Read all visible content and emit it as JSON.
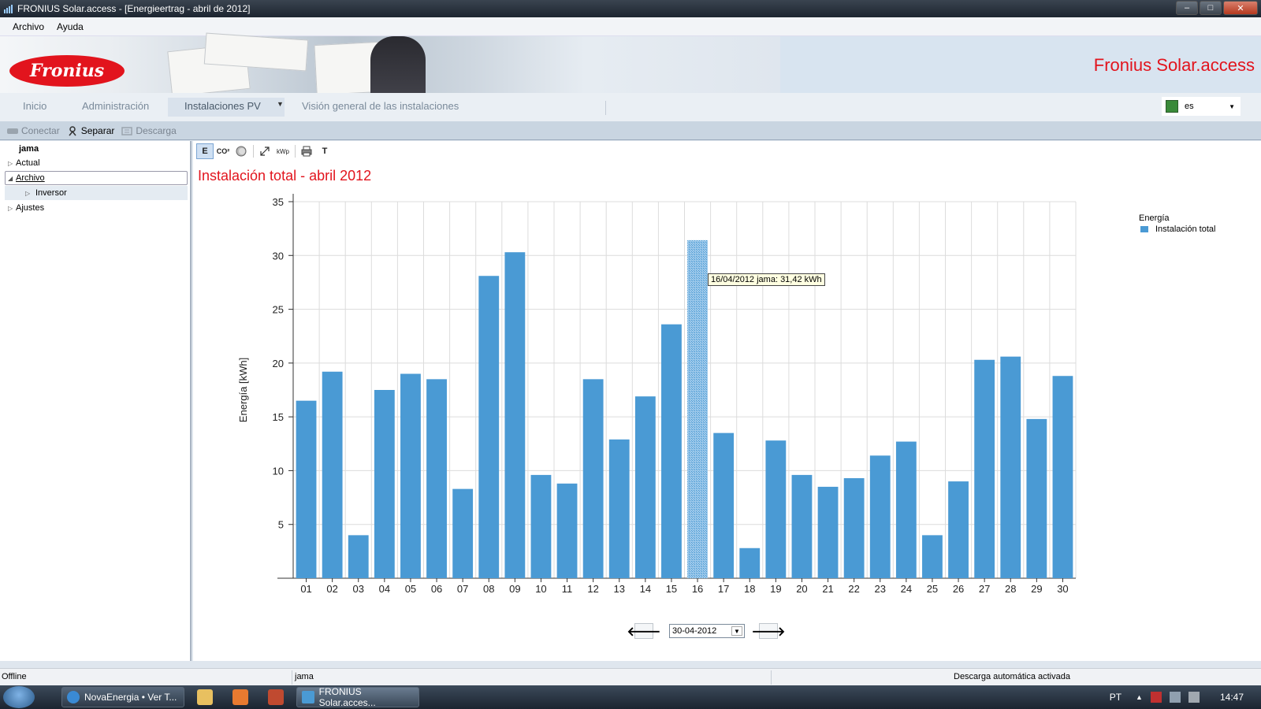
{
  "window": {
    "title": "FRONIUS Solar.access - [Energieertrag - abril de 2012]",
    "minimize": "–",
    "maximize": "□",
    "close": "✕"
  },
  "menu": [
    "Archivo",
    "Ayuda"
  ],
  "banner": {
    "logo_text": "Fronius",
    "title": "Fronius Solar.access"
  },
  "nav": {
    "tabs": [
      "Inicio",
      "Administración",
      "Instalaciones PV",
      "Visión general de las instalaciones"
    ],
    "active": "Instalaciones PV",
    "language": "es"
  },
  "toolbar": {
    "connect": "Conectar",
    "disconnect": "Separar",
    "download": "Descarga"
  },
  "tree": {
    "root": "jama",
    "items": [
      "Actual",
      "Archivo",
      "Inversor",
      "Ajustes"
    ]
  },
  "chart_toolbar": {
    "energy": "E",
    "co2": "CO²",
    "kwp": "kWp",
    "text": "T"
  },
  "chart_data": {
    "type": "bar",
    "title": "Instalación total - abril 2012",
    "ylabel": "Energía [kWh]",
    "xlabel": "",
    "ylim": [
      0,
      35
    ],
    "yticks": [
      5,
      10,
      15,
      20,
      25,
      30,
      35
    ],
    "categories": [
      "01",
      "02",
      "03",
      "04",
      "05",
      "06",
      "07",
      "08",
      "09",
      "10",
      "11",
      "12",
      "13",
      "14",
      "15",
      "16",
      "17",
      "18",
      "19",
      "20",
      "21",
      "22",
      "23",
      "24",
      "25",
      "26",
      "27",
      "28",
      "29",
      "30"
    ],
    "series": [
      {
        "name": "Instalación total",
        "values": [
          16.5,
          19.2,
          4.0,
          17.5,
          19.0,
          18.5,
          8.3,
          28.1,
          30.3,
          9.6,
          8.8,
          18.5,
          12.9,
          16.9,
          23.6,
          31.42,
          13.5,
          2.8,
          12.8,
          9.6,
          8.5,
          9.3,
          11.4,
          12.7,
          4.0,
          9.0,
          20.3,
          20.6,
          14.8,
          18.8
        ]
      }
    ],
    "legend_title": "Energía",
    "legend_position": "top-right",
    "highlighted_index": 15,
    "tooltip": "16/04/2012 jama: 31,42 kWh",
    "grid": true,
    "bar_color": "#4a9ad4"
  },
  "date_nav": {
    "value": "30-04-2012",
    "prev": "🡐",
    "next": "🡒"
  },
  "status": {
    "connection": "Offline",
    "system": "jama",
    "message": "Descarga automática activada"
  },
  "taskbar": {
    "tasks": [
      "NovaEnergia • Ver T...",
      "FRONIUS Solar.acces..."
    ],
    "lang": "PT",
    "time": "14:47"
  }
}
